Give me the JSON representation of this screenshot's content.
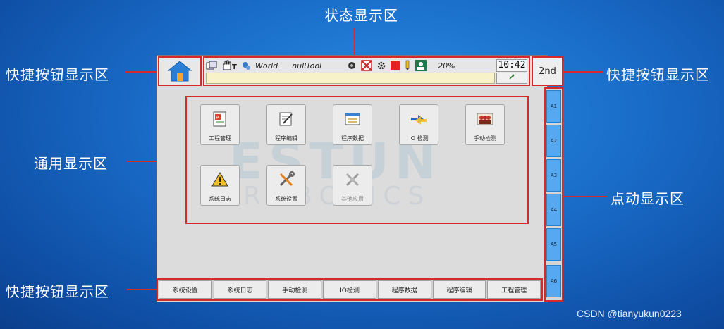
{
  "annotations": {
    "status_area": "状态显示区",
    "quick_left": "快捷按钮显示区",
    "quick_right": "快捷按钮显示区",
    "general_area": "通用显示区",
    "jog_area": "点动显示区",
    "quick_bottom": "快捷按钮显示区"
  },
  "status_bar": {
    "coord": "World",
    "tool": "nullTool",
    "speed": "20%",
    "clock": "10:42"
  },
  "second_key": "2nd",
  "watermark": {
    "brand": "ESTUN",
    "sub": "ROBOTICS"
  },
  "tiles": [
    {
      "label": "工程管理",
      "icon": "project-icon",
      "enabled": true
    },
    {
      "label": "程序编辑",
      "icon": "edit-icon",
      "enabled": true
    },
    {
      "label": "程序数据",
      "icon": "data-icon",
      "enabled": true
    },
    {
      "label": "IO 检测",
      "icon": "io-icon",
      "enabled": true
    },
    {
      "label": "手动检测",
      "icon": "manual-icon",
      "enabled": true
    },
    {
      "label": "系统日志",
      "icon": "warning-icon",
      "enabled": true
    },
    {
      "label": "系统设置",
      "icon": "tools-icon",
      "enabled": true
    },
    {
      "label": "其他应用",
      "icon": "apps-icon",
      "enabled": false
    }
  ],
  "jog_buttons": [
    "A1",
    "A2",
    "A3",
    "A4",
    "A5",
    "A6"
  ],
  "bottom_buttons": [
    "系统设置",
    "系统日志",
    "手动检测",
    "IO检测",
    "程序数据",
    "程序编辑",
    "工程管理"
  ],
  "watermark_credit": "CSDN @tianyukun0223",
  "colors": {
    "annotation_red": "#d62a2a",
    "jog_blue": "#56a9f0",
    "background_blue": "#1a6fcb"
  }
}
